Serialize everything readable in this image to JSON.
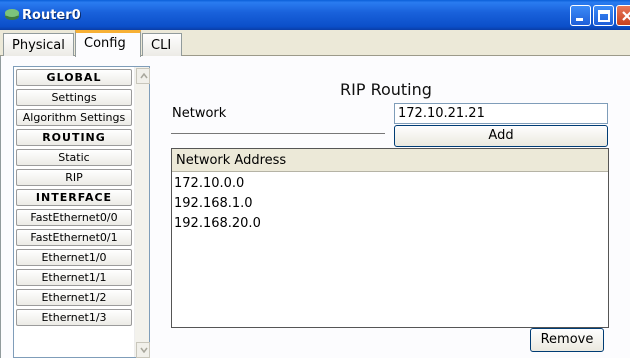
{
  "window": {
    "title": "Router0"
  },
  "tabs": [
    {
      "label": "Physical"
    },
    {
      "label": "Config"
    },
    {
      "label": "CLI"
    }
  ],
  "nav": {
    "items": [
      {
        "label": "GLOBAL",
        "header": true
      },
      {
        "label": "Settings"
      },
      {
        "label": "Algorithm Settings"
      },
      {
        "label": "ROUTING",
        "header": true
      },
      {
        "label": "Static"
      },
      {
        "label": "RIP"
      },
      {
        "label": "INTERFACE",
        "header": true
      },
      {
        "label": "FastEthernet0/0"
      },
      {
        "label": "FastEthernet0/1"
      },
      {
        "label": "Ethernet1/0"
      },
      {
        "label": "Ethernet1/1"
      },
      {
        "label": "Ethernet1/2"
      },
      {
        "label": "Ethernet1/3"
      }
    ]
  },
  "rip": {
    "title": "RIP Routing",
    "network_label": "Network",
    "network_value": "172.10.21.21",
    "add_label": "Add",
    "table_header": "Network Address",
    "addresses": [
      "172.10.0.0",
      "192.168.1.0",
      "192.168.20.0"
    ],
    "remove_label": "Remove"
  },
  "colors": {
    "titlebar": "#0b4fc9",
    "close_button": "#c7411e",
    "active_tab_accent": "#f7b035"
  }
}
